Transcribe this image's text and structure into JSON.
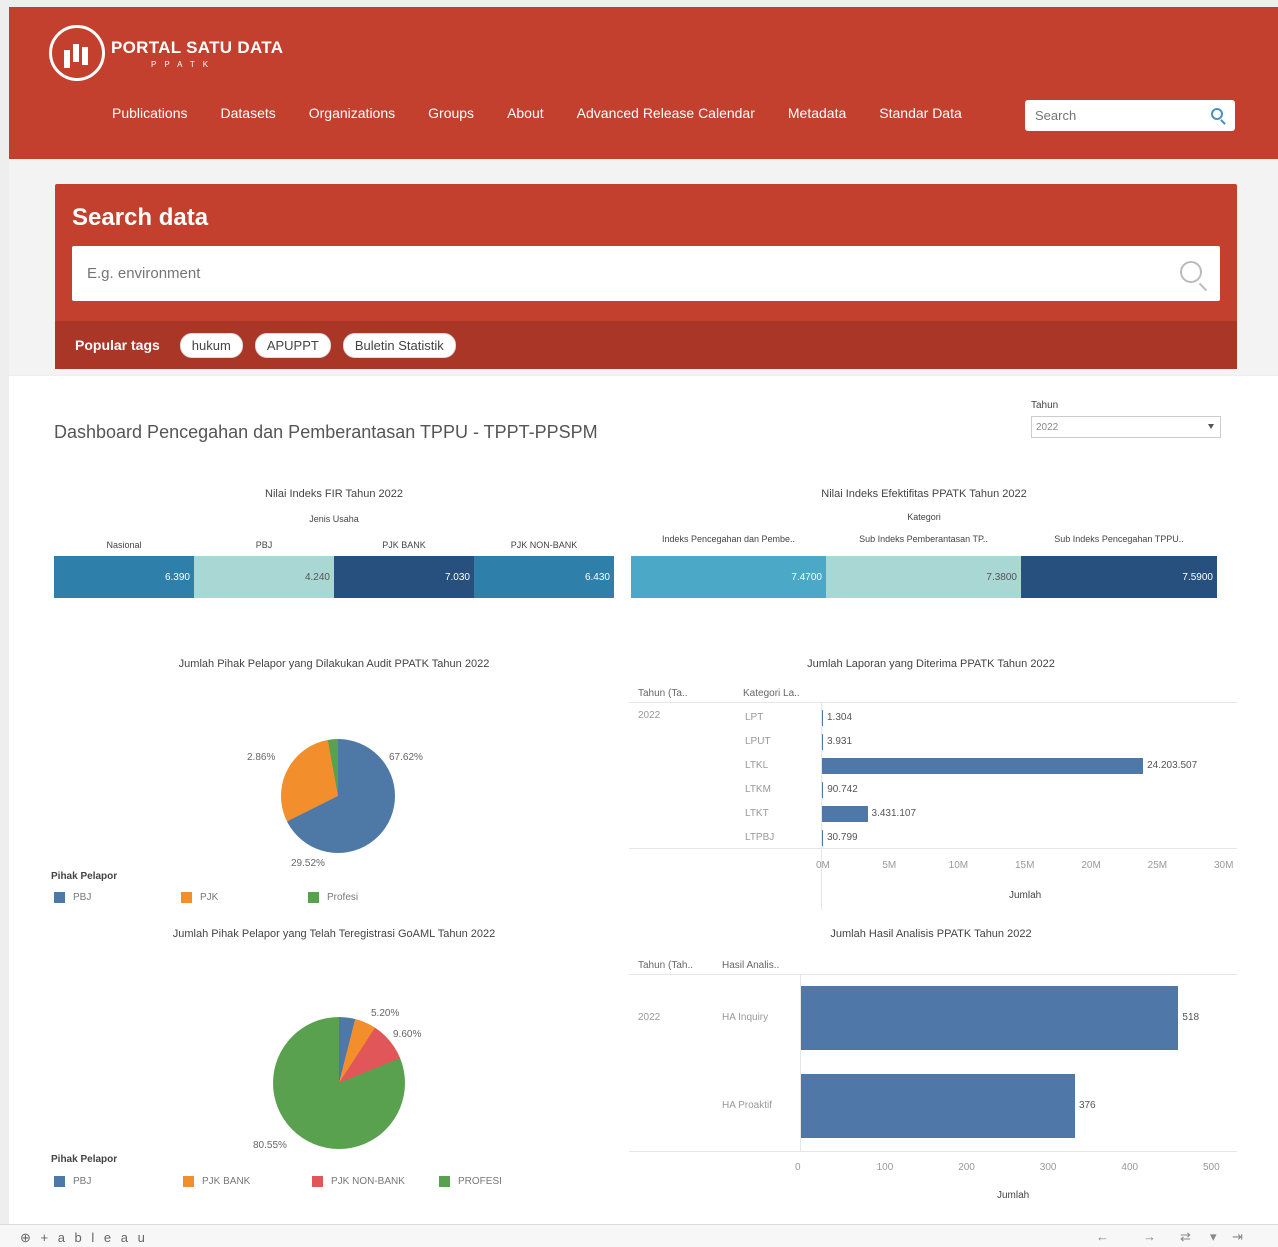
{
  "header": {
    "logo_title": "PORTAL SATU DATA",
    "logo_sub": "PPATK",
    "nav": [
      "Publications",
      "Datasets",
      "Organizations",
      "Groups",
      "About",
      "Advanced Release Calendar",
      "Metadata",
      "Standar Data"
    ],
    "search_placeholder": "Search"
  },
  "search": {
    "title": "Search data",
    "placeholder": "E.g. environment",
    "popular_label": "Popular tags",
    "tags": [
      "hukum",
      "APUPPT",
      "Buletin Statistik"
    ]
  },
  "dashboard": {
    "title": "Dashboard Pencegahan dan Pemberantasan TPPU - TPPT-PPSPM",
    "year_label": "Tahun",
    "year_value": "2022"
  },
  "colors": {
    "brand": "#c4402e",
    "brand_dark": "#a93626",
    "bar": "#4f78a8",
    "teal": "#2f7fab",
    "light_teal": "#a9d7d4",
    "navy": "#27507f",
    "sky": "#4ba8c6",
    "orange": "#f28e2b",
    "green": "#59a14f",
    "red": "#e15759",
    "blue": "#4e79a7"
  },
  "chart_data": [
    {
      "type": "table",
      "title": "Nilai Indeks FIR Tahun 2022",
      "group_header": "Jenis Usaha",
      "categories": [
        "Nasional",
        "PBJ",
        "PJK BANK",
        "PJK NON-BANK"
      ],
      "values": [
        6.39,
        4.24,
        7.03,
        6.43
      ],
      "value_labels": [
        "6.390",
        "4.240",
        "7.030",
        "6.430"
      ]
    },
    {
      "type": "table",
      "title": "Nilai Indeks Efektifitas PPATK Tahun 2022",
      "group_header": "Kategori",
      "categories": [
        "Indeks Pencegahan dan Pembe..",
        "Sub Indeks Pemberantasan TP..",
        "Sub Indeks Pencegahan TPPU.."
      ],
      "values": [
        7.47,
        7.38,
        7.59
      ],
      "value_labels": [
        "7.4700",
        "7.3800",
        "7.5900"
      ]
    },
    {
      "type": "pie",
      "title": "Jumlah Pihak Pelapor yang Dilakukan Audit PPATK Tahun 2022",
      "legend_title": "Pihak Pelapor",
      "labels": [
        "PBJ",
        "PJK",
        "Profesi"
      ],
      "values": [
        67.62,
        29.52,
        2.86
      ],
      "value_labels": [
        "67.62%",
        "29.52%",
        "2.86%"
      ]
    },
    {
      "type": "bar",
      "title": "Jumlah Laporan yang Diterima PPATK Tahun 2022",
      "col_headers": [
        "Tahun (Ta.. ",
        "Kategori La.."
      ],
      "year": "2022",
      "categories": [
        "LPT",
        "LPUT",
        "LTKL",
        "LTKM",
        "LTKT",
        "LTPBJ"
      ],
      "values": [
        1304,
        3931,
        24203507,
        90742,
        3431107,
        30799
      ],
      "value_labels": [
        "1.304",
        "3.931",
        "24.203.507",
        "90.742",
        "3.431.107",
        "30.799"
      ],
      "x_ticks": [
        "0M",
        "5M",
        "10M",
        "15M",
        "20M",
        "25M",
        "30M"
      ],
      "xlabel": "Jumlah",
      "xlim": [
        0,
        30000000
      ]
    },
    {
      "type": "pie",
      "title": "Jumlah Pihak Pelapor yang Telah Teregistrasi GoAML Tahun 2022",
      "legend_title": "Pihak Pelapor",
      "labels": [
        "PBJ",
        "PJK BANK",
        "PJK NON-BANK",
        "PROFESI"
      ],
      "values": [
        3.9,
        5.2,
        9.6,
        80.55
      ],
      "value_labels": [
        "5.20%",
        "9.60%",
        "80.55%"
      ]
    },
    {
      "type": "bar",
      "title": "Jumlah Hasil Analisis PPATK Tahun 2022",
      "col_headers": [
        "Tahun (Tah..",
        "Hasil Analis.."
      ],
      "year": "2022",
      "categories": [
        "HA Inquiry",
        "HA Proaktif"
      ],
      "values": [
        518,
        376
      ],
      "value_labels": [
        "518",
        "376"
      ],
      "x_ticks": [
        "0",
        "100",
        "200",
        "300",
        "400",
        "500"
      ],
      "xlabel": "Jumlah",
      "xlim": [
        0,
        560
      ]
    }
  ],
  "footer": {
    "brand": "+ a b l e a u"
  }
}
